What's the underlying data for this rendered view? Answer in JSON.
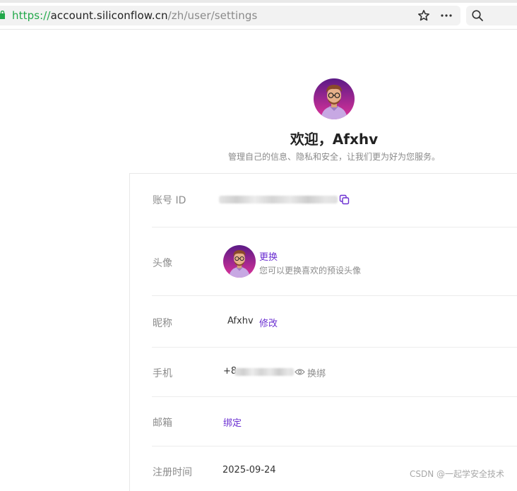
{
  "browser": {
    "url_scheme": "https://",
    "url_host": "account.siliconflow.cn",
    "url_path": "/zh/user/settings"
  },
  "header": {
    "welcome": "欢迎，Afxhv",
    "subtitle": "管理自己的信息、隐私和安全，让我们更为好为您服务。"
  },
  "settings": {
    "account_id": {
      "label": "账号 ID"
    },
    "avatar": {
      "label": "头像",
      "change_link": "更换",
      "hint": "您可以更换喜欢的预设头像"
    },
    "nickname": {
      "label": "昵称",
      "value": "Afxhv",
      "edit_link": "修改"
    },
    "phone": {
      "label": "手机",
      "value_prefix": "+8",
      "rebind_link": "换绑"
    },
    "email": {
      "label": "邮箱",
      "bind_link": "绑定"
    },
    "registered": {
      "label": "注册时间",
      "value": "2025-09-24"
    }
  },
  "icons": {
    "lock": "lock-icon",
    "bookmark": "star-icon",
    "menu": "more-icon",
    "search": "search-icon",
    "copy": "copy-icon",
    "reveal": "eye-icon"
  },
  "colors": {
    "accent": "#6b2fd1",
    "secure_scheme": "#22a84a",
    "avatar_bg_top": "#5b1a86",
    "avatar_bg_bottom": "#e0339a"
  },
  "watermark": "CSDN @一起学安全技术"
}
